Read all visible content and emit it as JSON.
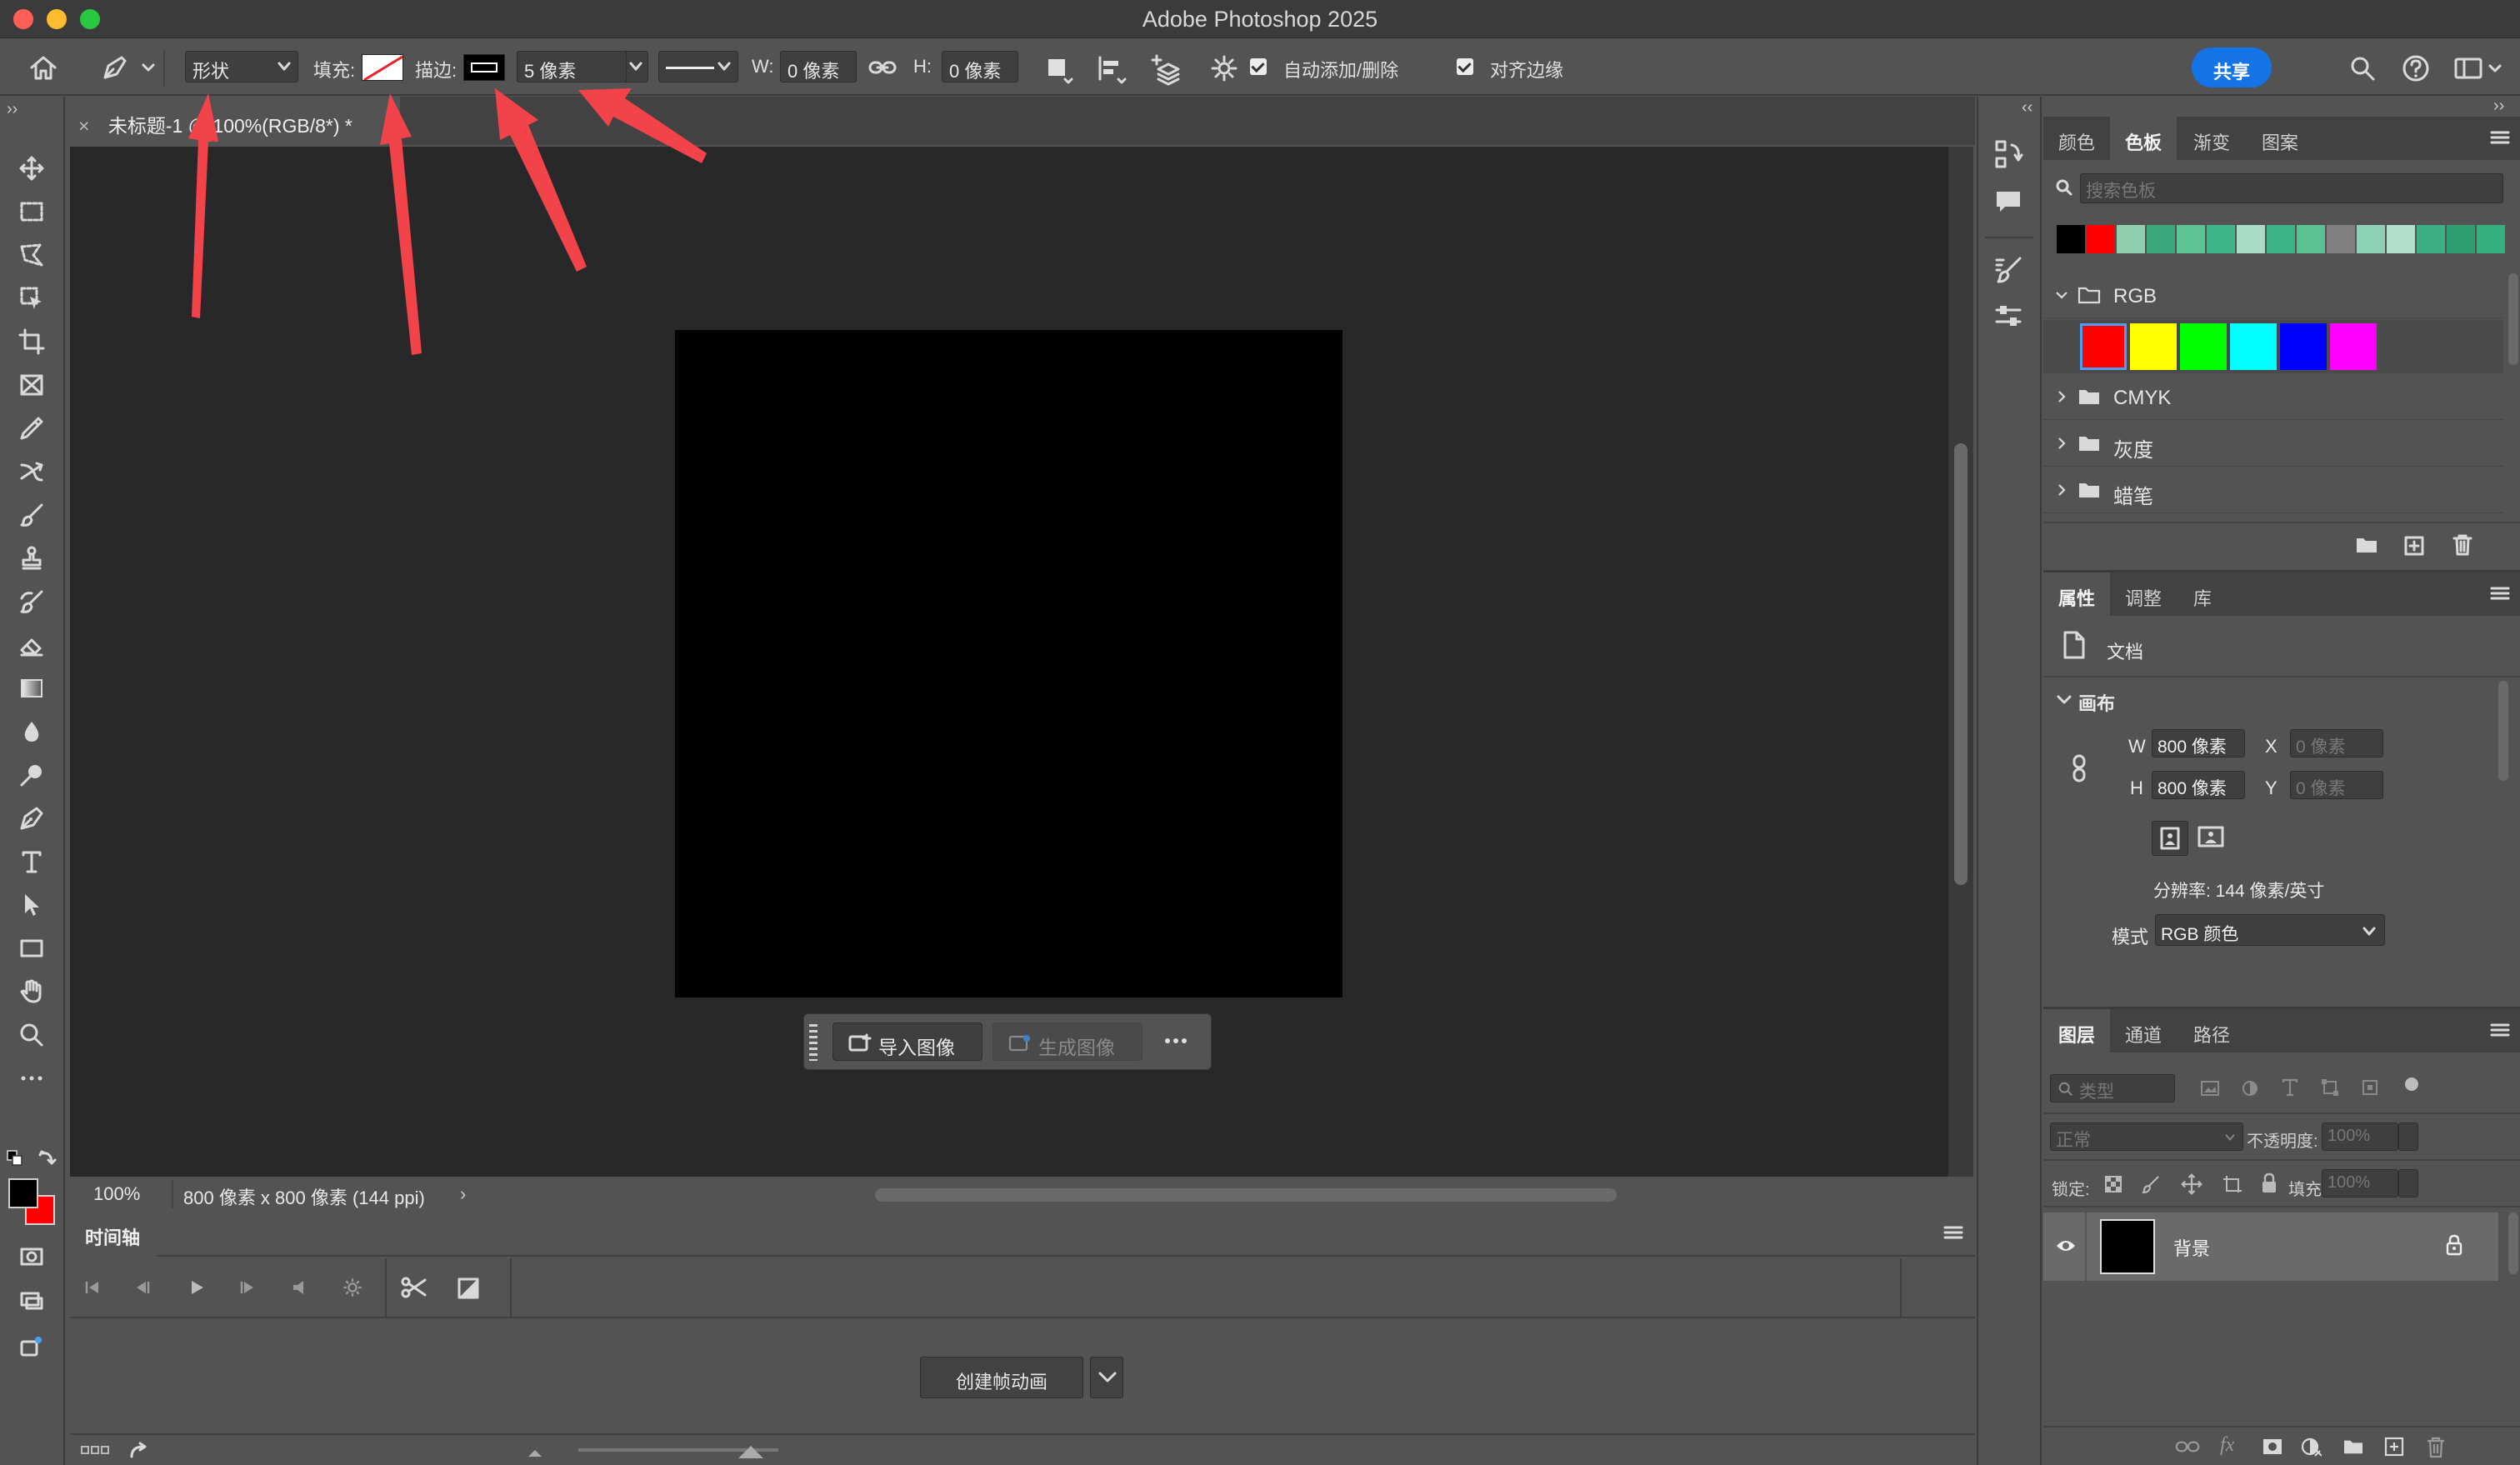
{
  "app_title": "Adobe Photoshop 2025",
  "options_bar": {
    "mode_value": "形状",
    "fill_label": "填充:",
    "stroke_label": "描边:",
    "stroke_width": "5 像素",
    "w_label": "W:",
    "w_value": "0 像素",
    "h_label": "H:",
    "h_value": "0 像素",
    "auto_add_delete": "自动添加/删除",
    "align_edges": "对齐边缘",
    "share": "共享"
  },
  "document": {
    "tab_title": "未标题-1 @ 100%(RGB/8*) *",
    "zoom": "100%",
    "doc_info": "800 像素 x 800 像素 (144 ppi)"
  },
  "contextual_bar": {
    "import_image": "导入图像",
    "generate_image": "生成图像"
  },
  "timeline": {
    "title": "时间轴",
    "create_button": "创建帧动画"
  },
  "swatches_panel": {
    "tabs": [
      "颜色",
      "色板",
      "渐变",
      "图案"
    ],
    "active_tab": "色板",
    "search_placeholder": "搜索色板",
    "recent_colors": [
      "#000000",
      "#ff0000",
      "#8fcfb0",
      "#3aa87a",
      "#5fc295",
      "#3fb58a",
      "#a8dcc4",
      "#3cb387",
      "#5cc092",
      "#808080",
      "#8fd1b5",
      "#b0e0cc",
      "#3cae84",
      "#2e9f70",
      "#33b07e"
    ],
    "groups": [
      {
        "name": "RGB",
        "expanded": true,
        "colors": [
          "#ff0000",
          "#ffff00",
          "#00ff00",
          "#00ffff",
          "#0000ff",
          "#ff00ff"
        ]
      },
      {
        "name": "CMYK",
        "expanded": false
      },
      {
        "name": "灰度",
        "expanded": false
      },
      {
        "name": "蜡笔",
        "expanded": false
      }
    ]
  },
  "properties_panel": {
    "tabs": [
      "属性",
      "调整",
      "库"
    ],
    "active_tab": "属性",
    "doc_label": "文档",
    "canvas_section": "画布",
    "w_label": "W",
    "w_value": "800 像素",
    "h_label": "H",
    "h_value": "800 像素",
    "x_label": "X",
    "x_value": "0 像素",
    "y_label": "Y",
    "y_value": "0 像素",
    "resolution": "分辨率: 144 像素/英寸",
    "mode_label": "模式",
    "mode_value": "RGB 颜色"
  },
  "layers_panel": {
    "tabs": [
      "图层",
      "通道",
      "路径"
    ],
    "active_tab": "图层",
    "filter_kind": "类型",
    "blend_mode": "正常",
    "opacity_label": "不透明度:",
    "opacity_value": "100%",
    "lock_label": "锁定:",
    "fill_label": "填充:",
    "fill_value": "100%",
    "layers": [
      {
        "name": "背景",
        "thumbnail_color": "#000000",
        "locked": true,
        "visible": true
      }
    ]
  },
  "colors": {
    "foreground": "#000000",
    "background": "#ff0000",
    "share_button": "#1473e6",
    "annotation_arrow": "#f2424a"
  }
}
